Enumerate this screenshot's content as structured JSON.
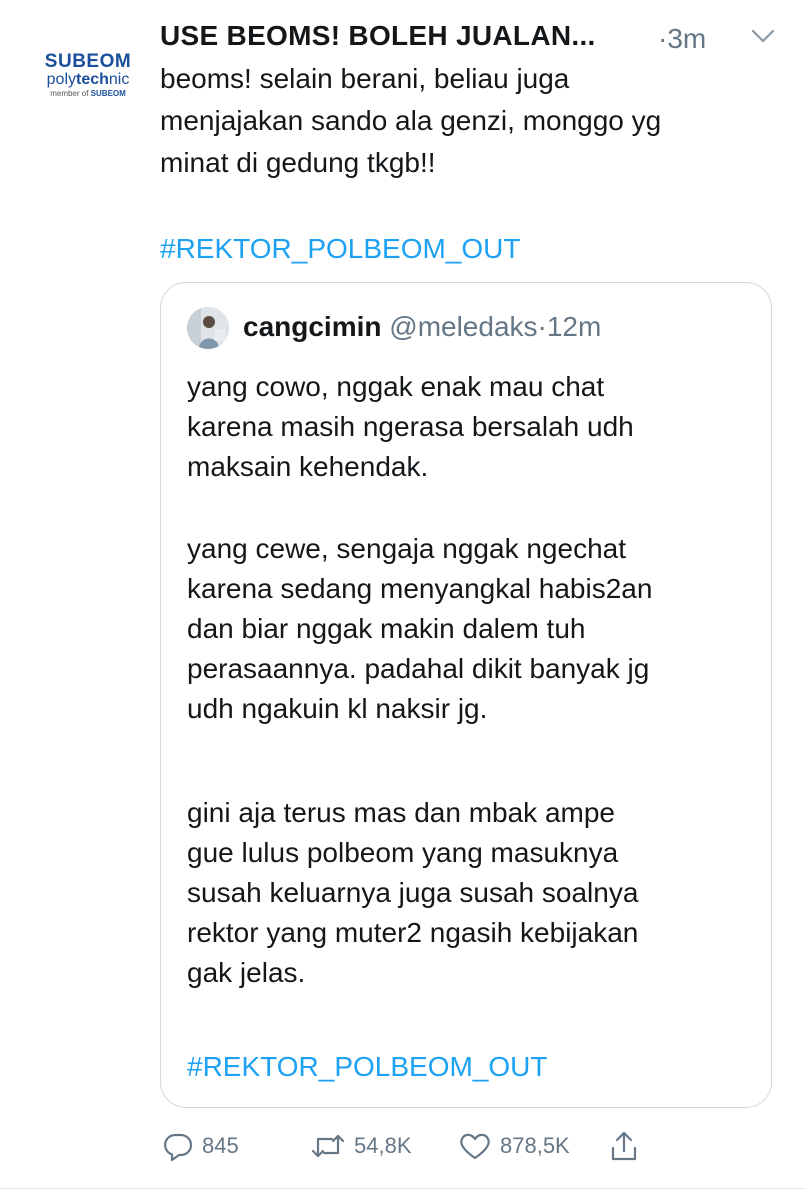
{
  "account": {
    "logo_main": "SUBEOM",
    "logo_sub_1": "poly",
    "logo_sub_2": "tech",
    "logo_sub_3": "nic",
    "logo_member": "member of ",
    "logo_member_brand": "SUBEOM"
  },
  "tweet": {
    "display_name": "USE BEOMS! BOLEH JUALAN...",
    "time": "·3m",
    "text": "beoms! selain berani, beliau juga\nmenjajakan sando ala genzi, monggo yg\nminat di gedung tkgb!!",
    "hashtag": "#REKTOR_POLBEOM_OUT"
  },
  "quote": {
    "name": "cangcimin",
    "handle": "@meledaks",
    "time": "·12m",
    "paragraph_1": "yang cowo, nggak enak mau chat\nkarena masih ngerasa bersalah udh\nmaksain kehendak.",
    "paragraph_2": "yang cewe, sengaja nggak ngechat\nkarena sedang menyangkal habis2an\ndan biar nggak makin dalem tuh\nperasaannya. padahal dikit banyak jg\nudh ngakuin kl naksir jg.",
    "paragraph_3": "gini aja terus mas dan mbak ampe\ngue lulus polbeom yang masuknya\nsusah keluarnya juga susah soalnya\nrektor yang muter2 ngasih kebijakan\ngak jelas.",
    "hashtag": "#REKTOR_POLBEOM_OUT"
  },
  "actions": {
    "replies": "845",
    "retweets": "54,8K",
    "likes": "878,5K"
  },
  "colors": {
    "link": "#1da1f2",
    "muted": "#657786",
    "brand": "#1b4f9c"
  }
}
